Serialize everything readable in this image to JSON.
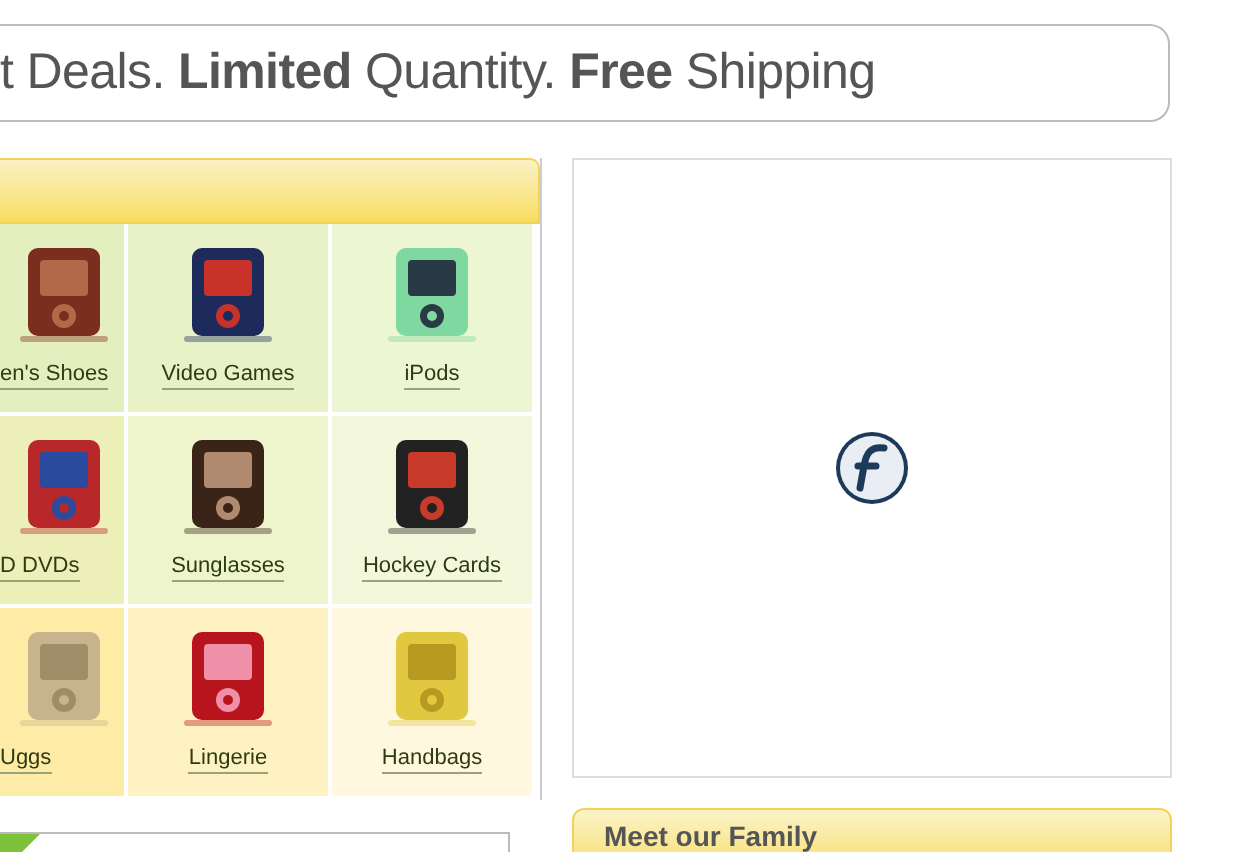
{
  "banner": {
    "text": "t Deals. **Limited** Quantity. **Free** Shipping"
  },
  "categories": [
    {
      "label": "en's Shoes"
    },
    {
      "label": "Video Games"
    },
    {
      "label": "iPods"
    },
    {
      "label": "D DVDs"
    },
    {
      "label": "Sunglasses"
    },
    {
      "label": "Hockey Cards"
    },
    {
      "label": "Uggs"
    },
    {
      "label": "Lingerie"
    },
    {
      "label": "Handbags"
    }
  ],
  "family": {
    "heading": "Meet our Family"
  }
}
